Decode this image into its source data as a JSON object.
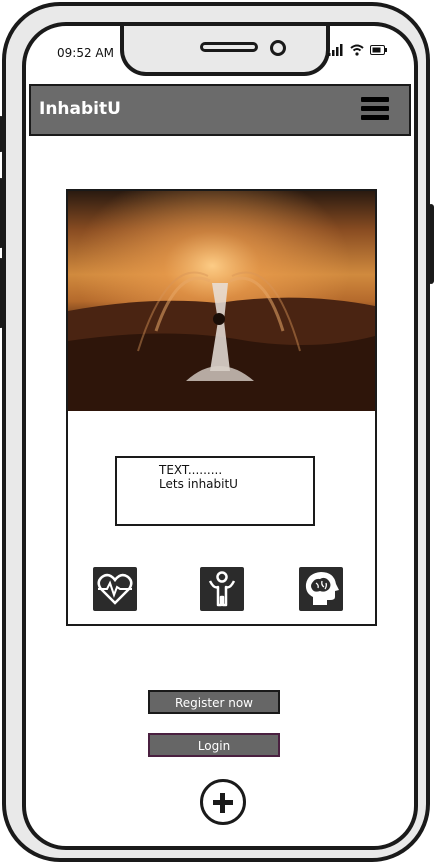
{
  "status_bar": {
    "time": "09:52 AM"
  },
  "app": {
    "title": "InhabitU"
  },
  "card": {
    "text_line1": "TEXT.........",
    "text_line2": "Lets inhabitU",
    "feature_icons": [
      "heart-pulse-icon",
      "child-icon",
      "brain-head-icon"
    ]
  },
  "buttons": {
    "register_label": "Register now",
    "login_label": "Login"
  },
  "colors": {
    "header": "#6b6b6b",
    "button": "#666666",
    "icon_tile": "#2b2b2b"
  }
}
